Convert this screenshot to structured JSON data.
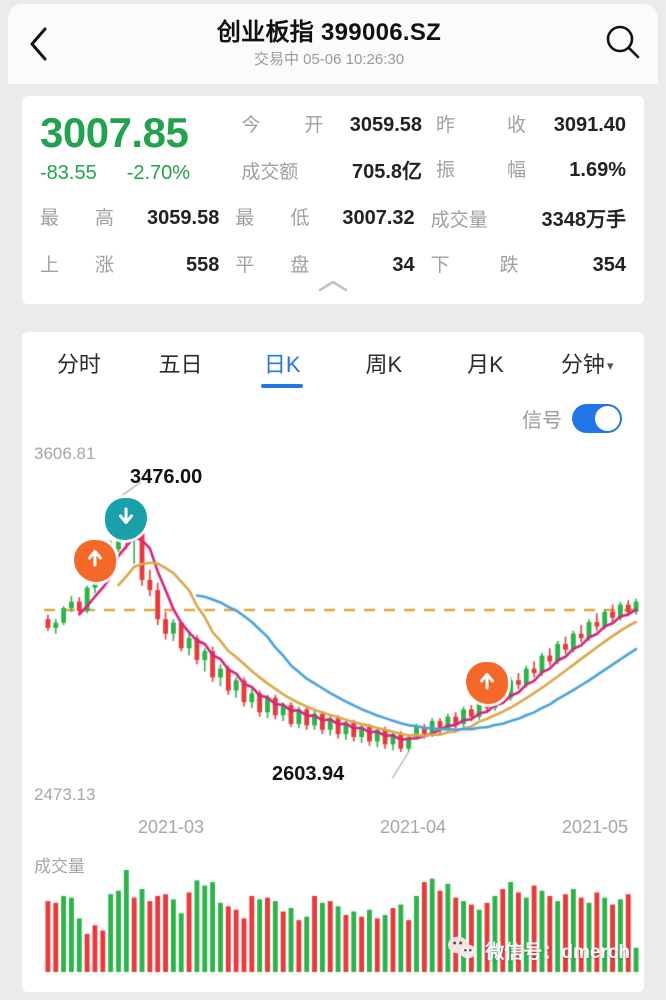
{
  "header": {
    "back_icon": "chevron-left-icon",
    "title": "创业板指 399006.SZ",
    "subtitle": "交易中 05-06 10:26:30",
    "search_icon": "search-icon"
  },
  "quote": {
    "last_price": "3007.85",
    "change": "-83.55",
    "change_pct": "-2.70%",
    "change_color": "#23a24d",
    "fields": [
      {
        "label_a": "今",
        "label_b": "开",
        "value": "3059.58"
      },
      {
        "label_a": "昨",
        "label_b": "收",
        "value": "3091.40"
      },
      {
        "label_a": "成交额",
        "label_b": "",
        "value": "705.8亿"
      },
      {
        "label_a": "振",
        "label_b": "幅",
        "value": "1.69%"
      },
      {
        "label_a": "最",
        "label_b": "高",
        "value": "3059.58"
      },
      {
        "label_a": "最",
        "label_b": "低",
        "value": "3007.32"
      },
      {
        "label_a": "成交量",
        "label_b": "",
        "value": "3348万手"
      },
      {
        "label_a": "上",
        "label_b": "涨",
        "value": "558"
      },
      {
        "label_a": "平",
        "label_b": "盘",
        "value": "34"
      },
      {
        "label_a": "下",
        "label_b": "跌",
        "value": "354"
      }
    ],
    "collapse_icon": "chevron-up-icon"
  },
  "chart_tabs": {
    "items": [
      {
        "label": "分时",
        "active": false
      },
      {
        "label": "五日",
        "active": false
      },
      {
        "label": "日K",
        "active": true
      },
      {
        "label": "周K",
        "active": false
      },
      {
        "label": "月K",
        "active": false
      },
      {
        "label": "分钟",
        "active": false,
        "caret": "▾"
      }
    ],
    "accent_color": "#2277e8"
  },
  "signal": {
    "label": "信号",
    "enabled": true,
    "on_color": "#2277e8"
  },
  "chart_data": {
    "type": "candlestick",
    "title": "创业板指 399006.SZ 日K",
    "ylim": [
      2473.13,
      3606.81
    ],
    "y_top_label": "3606.81",
    "y_bottom_label": "2473.13",
    "grid": false,
    "x_tick_labels": [
      "2021-03",
      "2021-04",
      "2021-05"
    ],
    "x_tick_positions": [
      0.27,
      0.65,
      0.94
    ],
    "annotations": [
      {
        "text": "3476.00",
        "kind": "high",
        "x_index": 9,
        "value": 3476.0
      },
      {
        "text": "2603.94",
        "kind": "low",
        "x_index": 46,
        "value": 2603.94
      }
    ],
    "reference_line": {
      "value": 3091.4,
      "style": "dashed",
      "color": "#e0a83a"
    },
    "up_color": "#2cb34a",
    "down_color": "#e8393b",
    "ma_lines": [
      {
        "name": "MA5",
        "color": "#d6257e"
      },
      {
        "name": "MA10",
        "color": "#d9a94e"
      },
      {
        "name": "MA20",
        "color": "#4aa3dd"
      }
    ],
    "signal_markers": [
      {
        "type": "buy",
        "icon": "arrow-up-icon",
        "x_index": 6,
        "value": 3260,
        "color": "#f4682a"
      },
      {
        "type": "sell",
        "icon": "arrow-down-icon",
        "x_index": 10,
        "value": 3405,
        "color": "#19a0a8"
      },
      {
        "type": "buy",
        "icon": "arrow-up-icon",
        "x_index": 56,
        "value": 2840,
        "color": "#f4682a"
      }
    ],
    "volume_label": "成交量",
    "ohlc": [
      [
        3060,
        3075,
        3020,
        3030
      ],
      [
        3030,
        3060,
        3010,
        3048
      ],
      [
        3048,
        3105,
        3040,
        3098
      ],
      [
        3098,
        3140,
        3085,
        3120
      ],
      [
        3120,
        3135,
        3075,
        3088
      ],
      [
        3088,
        3175,
        3080,
        3168
      ],
      [
        3168,
        3230,
        3150,
        3215
      ],
      [
        3215,
        3290,
        3200,
        3250
      ],
      [
        3250,
        3330,
        3240,
        3300
      ],
      [
        3300,
        3476,
        3290,
        3455
      ],
      [
        3455,
        3462,
        3300,
        3330
      ],
      [
        3330,
        3390,
        3250,
        3375
      ],
      [
        3375,
        3385,
        3175,
        3195
      ],
      [
        3195,
        3230,
        3140,
        3160
      ],
      [
        3160,
        3185,
        3040,
        3060
      ],
      [
        3060,
        3085,
        2990,
        3010
      ],
      [
        3010,
        3060,
        2985,
        3048
      ],
      [
        3048,
        3055,
        2950,
        2960
      ],
      [
        2960,
        3010,
        2935,
        2995
      ],
      [
        2995,
        3005,
        2905,
        2920
      ],
      [
        2920,
        2960,
        2880,
        2950
      ],
      [
        2950,
        2965,
        2845,
        2860
      ],
      [
        2860,
        2905,
        2830,
        2890
      ],
      [
        2890,
        2900,
        2800,
        2815
      ],
      [
        2815,
        2860,
        2790,
        2850
      ],
      [
        2850,
        2860,
        2760,
        2775
      ],
      [
        2775,
        2820,
        2755,
        2805
      ],
      [
        2805,
        2815,
        2725,
        2740
      ],
      [
        2740,
        2800,
        2720,
        2790
      ],
      [
        2790,
        2800,
        2715,
        2730
      ],
      [
        2730,
        2775,
        2710,
        2765
      ],
      [
        2765,
        2775,
        2690,
        2700
      ],
      [
        2700,
        2760,
        2685,
        2750
      ],
      [
        2750,
        2760,
        2680,
        2695
      ],
      [
        2695,
        2745,
        2680,
        2735
      ],
      [
        2735,
        2745,
        2665,
        2680
      ],
      [
        2680,
        2730,
        2660,
        2720
      ],
      [
        2720,
        2730,
        2650,
        2665
      ],
      [
        2665,
        2715,
        2645,
        2705
      ],
      [
        2705,
        2715,
        2640,
        2655
      ],
      [
        2655,
        2700,
        2635,
        2690
      ],
      [
        2690,
        2700,
        2625,
        2640
      ],
      [
        2640,
        2690,
        2620,
        2680
      ],
      [
        2680,
        2690,
        2615,
        2630
      ],
      [
        2630,
        2675,
        2610,
        2665
      ],
      [
        2665,
        2675,
        2604,
        2615
      ],
      [
        2615,
        2665,
        2603.94,
        2655
      ],
      [
        2655,
        2700,
        2645,
        2690
      ],
      [
        2690,
        2700,
        2650,
        2665
      ],
      [
        2665,
        2720,
        2655,
        2710
      ],
      [
        2710,
        2720,
        2665,
        2680
      ],
      [
        2680,
        2735,
        2670,
        2725
      ],
      [
        2725,
        2740,
        2685,
        2700
      ],
      [
        2700,
        2760,
        2690,
        2750
      ],
      [
        2750,
        2765,
        2710,
        2725
      ],
      [
        2725,
        2790,
        2715,
        2780
      ],
      [
        2780,
        2800,
        2740,
        2755
      ],
      [
        2755,
        2820,
        2745,
        2810
      ],
      [
        2810,
        2830,
        2775,
        2790
      ],
      [
        2790,
        2860,
        2780,
        2850
      ],
      [
        2850,
        2875,
        2820,
        2835
      ],
      [
        2835,
        2900,
        2825,
        2890
      ],
      [
        2890,
        2915,
        2860,
        2875
      ],
      [
        2875,
        2945,
        2865,
        2935
      ],
      [
        2935,
        2960,
        2900,
        2915
      ],
      [
        2915,
        2985,
        2905,
        2975
      ],
      [
        2975,
        3000,
        2940,
        2955
      ],
      [
        2955,
        3020,
        2945,
        3010
      ],
      [
        3010,
        3040,
        2980,
        2995
      ],
      [
        2995,
        3060,
        2985,
        3050
      ],
      [
        3050,
        3080,
        3020,
        3035
      ],
      [
        3035,
        3095,
        3025,
        3085
      ],
      [
        3085,
        3110,
        3050,
        3065
      ],
      [
        3065,
        3120,
        3055,
        3110
      ],
      [
        3110,
        3125,
        3070,
        3085
      ],
      [
        3085,
        3130,
        3075,
        3120
      ]
    ],
    "volumes": [
      82,
      80,
      88,
      86,
      62,
      44,
      54,
      48,
      90,
      94,
      118,
      86,
      96,
      82,
      88,
      90,
      84,
      68,
      92,
      106,
      100,
      104,
      80,
      76,
      72,
      62,
      88,
      84,
      86,
      82,
      70,
      74,
      60,
      64,
      88,
      80,
      82,
      76,
      66,
      70,
      64,
      72,
      62,
      66,
      74,
      78,
      60,
      88,
      104,
      108,
      94,
      102,
      86,
      82,
      78,
      72,
      80,
      88,
      96,
      104,
      92,
      86,
      100,
      94,
      88,
      82,
      90,
      96,
      86,
      80,
      92,
      86,
      78,
      84,
      90,
      28
    ],
    "volume_colors": [
      "d",
      "d",
      "u",
      "u",
      "u",
      "d",
      "d",
      "d",
      "u",
      "u",
      "u",
      "d",
      "u",
      "d",
      "d",
      "d",
      "u",
      "u",
      "d",
      "u",
      "u",
      "u",
      "u",
      "d",
      "d",
      "d",
      "d",
      "u",
      "d",
      "u",
      "d",
      "u",
      "d",
      "u",
      "d",
      "u",
      "d",
      "u",
      "d",
      "u",
      "d",
      "u",
      "d",
      "u",
      "d",
      "u",
      "d",
      "u",
      "d",
      "u",
      "d",
      "u",
      "d",
      "u",
      "d",
      "u",
      "d",
      "u",
      "d",
      "u",
      "d",
      "u",
      "d",
      "u",
      "d",
      "u",
      "d",
      "u",
      "d",
      "u",
      "d",
      "u",
      "d",
      "u",
      "d",
      "u"
    ]
  },
  "watermark": {
    "icon": "wechat-icon",
    "text": "微信号：dmerch"
  }
}
